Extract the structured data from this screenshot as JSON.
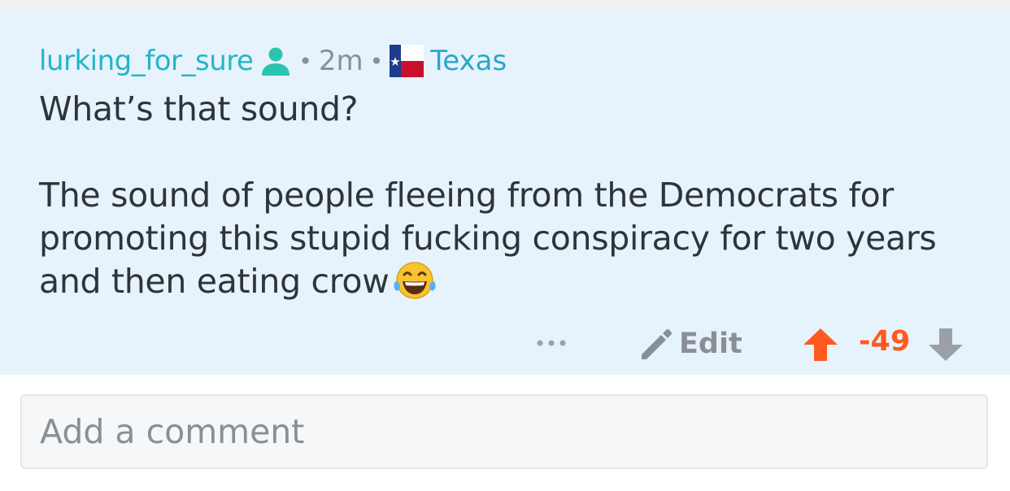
{
  "comment": {
    "username": "lurking_for_sure",
    "separator": "•",
    "age": "2m",
    "flair": "Texas",
    "body_line1": "What’s that sound?",
    "body_line2": "The sound of people fleeing from the Democrats for promoting this stupid fucking conspiracy for two years and then eating crow",
    "icons": {
      "user": "user-icon",
      "flag": "texas-flag-icon",
      "emoji": "tears-of-joy-emoji-icon",
      "more": "more-icon",
      "edit": "pencil-icon",
      "upvote": "upvote-arrow-icon",
      "downvote": "downvote-arrow-icon"
    }
  },
  "actions": {
    "edit_label": "Edit",
    "score": "-49"
  },
  "composer": {
    "placeholder": "Add a comment"
  },
  "colors": {
    "card_background": "#e6f3fc",
    "username": "#24b5c7",
    "flair": "#2aa7c9",
    "upvote_active": "#ff5a1f",
    "muted": "#8a8f96"
  }
}
